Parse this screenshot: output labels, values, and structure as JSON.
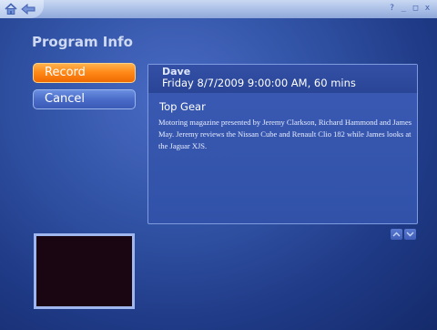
{
  "window": {
    "nav": {
      "home_icon": "home-icon",
      "back_icon": "back-arrow-icon"
    },
    "controls": [
      "?",
      "_",
      "□",
      "x"
    ]
  },
  "page": {
    "title": "Program Info"
  },
  "actions": {
    "record_label": "Record",
    "cancel_label": "Cancel"
  },
  "program": {
    "channel": "Dave",
    "airtime": "Friday 8/7/2009 9:00:00 AM, 60 mins",
    "title": "Top Gear",
    "description": "Motoring magazine presented by Jeremy Clarkson, Richard Hammond and James May. Jeremy reviews the Nissan Cube and Renault Clio 182 while James looks at the Jaguar XJS."
  },
  "colors": {
    "accent_orange": "#ff8a1a",
    "panel_blue": "#3152a8",
    "background": "#2a4a9e"
  }
}
